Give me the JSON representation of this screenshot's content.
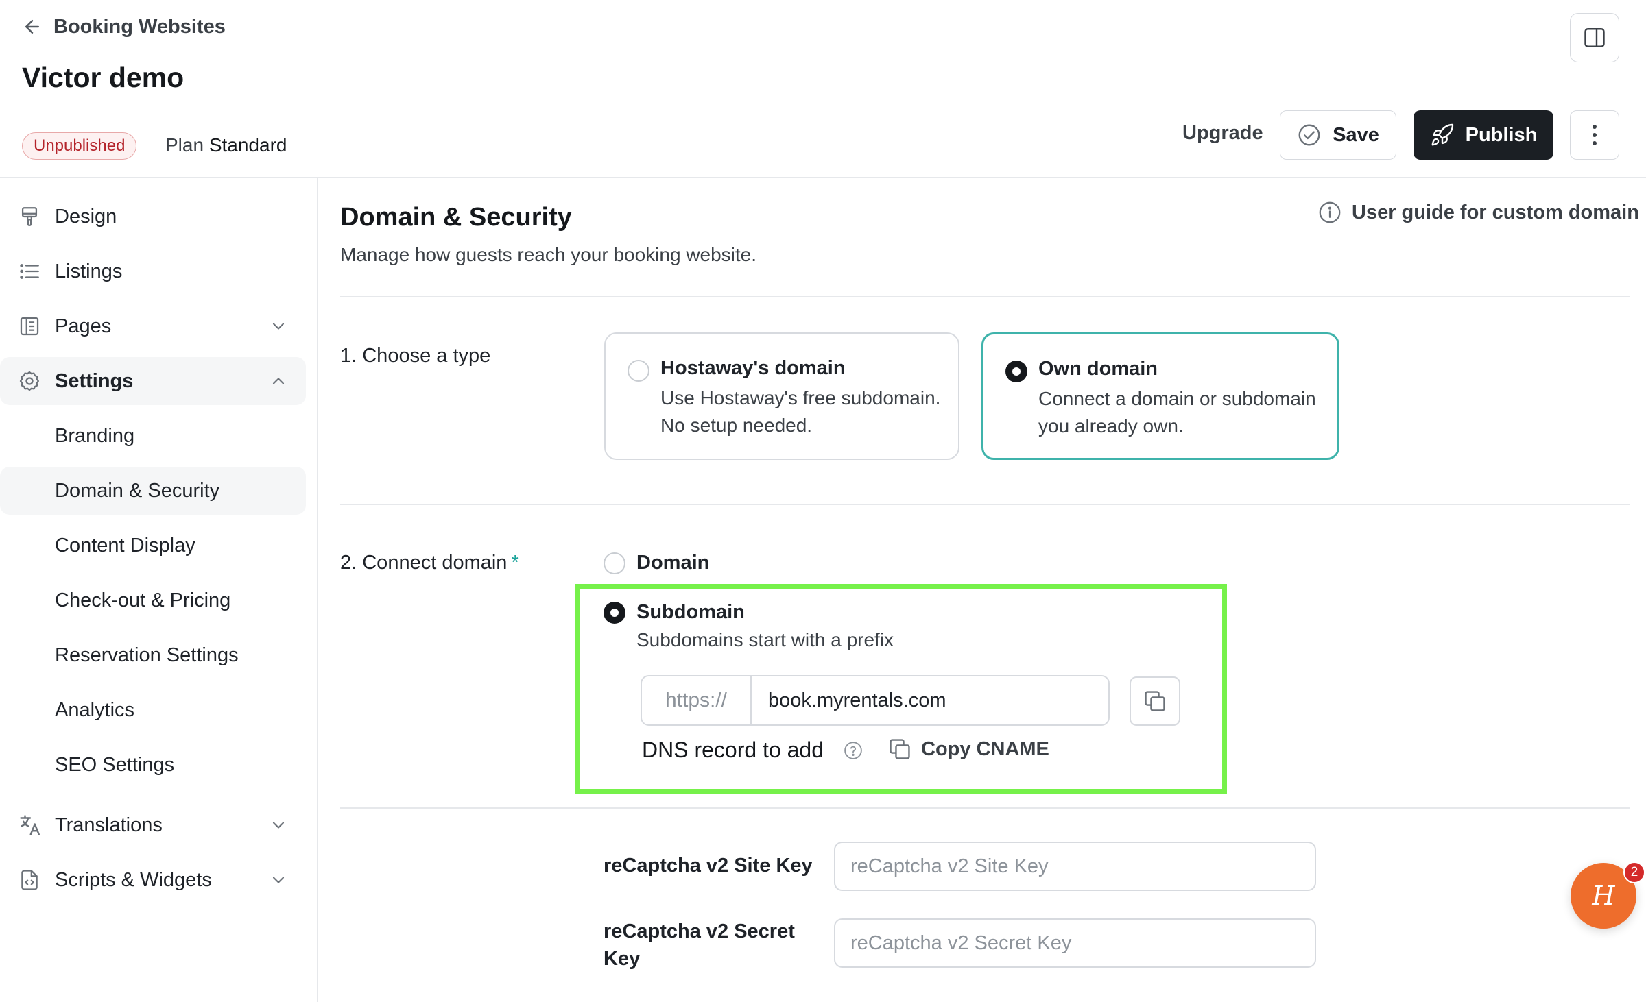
{
  "header": {
    "back_label": "Booking Websites",
    "title": "Victor demo",
    "status_badge": "Unpublished",
    "plan_label": "Plan",
    "plan_name": "Standard",
    "upgrade_label": "Upgrade",
    "save_label": "Save",
    "publish_label": "Publish"
  },
  "sidebar": {
    "items": [
      {
        "label": "Design"
      },
      {
        "label": "Listings"
      },
      {
        "label": "Pages"
      },
      {
        "label": "Settings"
      },
      {
        "label": "Translations"
      },
      {
        "label": "Scripts & Widgets"
      }
    ],
    "settings_sub": [
      {
        "label": "Branding"
      },
      {
        "label": "Domain & Security"
      },
      {
        "label": "Content Display"
      },
      {
        "label": "Check-out & Pricing"
      },
      {
        "label": "Reservation Settings"
      },
      {
        "label": "Analytics"
      },
      {
        "label": "SEO Settings"
      }
    ]
  },
  "main": {
    "title": "Domain & Security",
    "subtitle": "Manage how guests reach your booking website.",
    "guide_link": "User guide for custom domain",
    "choose_type": {
      "label": "1. Choose a type",
      "options": [
        {
          "title": "Hostaway's domain",
          "desc": "Use Hostaway's free subdomain. No setup needed.",
          "selected": false
        },
        {
          "title": "Own domain",
          "desc": "Connect a domain or subdomain you already own.",
          "selected": true
        }
      ]
    },
    "connect": {
      "label": "2. Connect domain",
      "required_mark": "*",
      "domain_option": "Domain",
      "subdomain_option": "Subdomain",
      "subdomain_desc": "Subdomains start with a prefix",
      "url_prefix": "https://",
      "url_value": "book.myrentals.com",
      "dns_label": "DNS record to add",
      "copy_cname": "Copy CNAME"
    },
    "recaptcha": {
      "site_key_label": "reCaptcha v2 Site Key",
      "site_key_placeholder": "reCaptcha v2 Site Key",
      "secret_key_label": "reCaptcha v2 Secret Key",
      "secret_key_placeholder": "reCaptcha v2 Secret Key"
    }
  },
  "chat": {
    "badge_count": "2",
    "glyph": "H"
  },
  "colors": {
    "accent_teal": "#3fb3ab",
    "publish_bg": "#1b1f24",
    "badge_red": "#b4232a",
    "highlight_green": "#76f14a",
    "chat_orange": "#ee6d2c"
  }
}
